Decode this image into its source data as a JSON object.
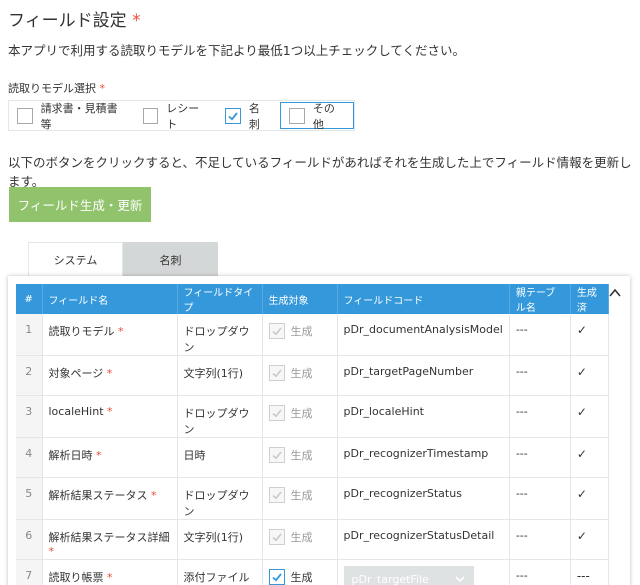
{
  "header": {
    "title": "フィールド設定",
    "required_mark": "*",
    "description": "本アプリで利用する読取りモデルを下記より最低1つ以上チェックしてください。"
  },
  "model_select": {
    "label": "読取りモデル選択",
    "required_mark": "*",
    "options": [
      {
        "label": "請求書・見積書等",
        "checked": false
      },
      {
        "label": "レシート",
        "checked": false
      },
      {
        "label": "名刺",
        "checked": true
      },
      {
        "label": "その他",
        "checked": false
      }
    ]
  },
  "generate": {
    "description": "以下のボタンをクリックすると、不足しているフィールドがあればそれを生成した上でフィールド情報を更新します。",
    "button_label": "フィールド生成・更新"
  },
  "tabs": [
    {
      "label": "システム",
      "active": true
    },
    {
      "label": "名刺",
      "active": false
    }
  ],
  "table": {
    "headers": [
      "#",
      "フィールド名",
      "フィールドタイプ",
      "生成対象",
      "フィールドコード",
      "親テーブル名",
      "生成済"
    ],
    "required_mark": "*",
    "gen_label": "生成",
    "rows": [
      {
        "num": "1",
        "name": "読取りモデル",
        "type": "ドロップダウン",
        "code": "pDr_documentAnalysisModel",
        "parent": "---",
        "done": "✓"
      },
      {
        "num": "2",
        "name": "対象ページ",
        "type": "文字列(1行)",
        "code": "pDr_targetPageNumber",
        "parent": "---",
        "done": "✓"
      },
      {
        "num": "3",
        "name": "localeHint",
        "type": "ドロップダウン",
        "code": "pDr_localeHint",
        "parent": "---",
        "done": "✓"
      },
      {
        "num": "4",
        "name": "解析日時",
        "type": "日時",
        "code": "pDr_recognizerTimestamp",
        "parent": "---",
        "done": "✓"
      },
      {
        "num": "5",
        "name": "解析結果ステータス",
        "type": "ドロップダウン",
        "code": "pDr_recognizerStatus",
        "parent": "---",
        "done": "✓"
      },
      {
        "num": "6",
        "name": "解析結果ステータス詳細",
        "type": "文字列(1行)",
        "code": "pDr_recognizerStatusDetail",
        "parent": "---",
        "done": "✓"
      },
      {
        "num": "7",
        "name": "読取り帳票",
        "type": "添付ファイル",
        "code": "pDr_targetFile",
        "parent": "---",
        "done": "---"
      }
    ]
  },
  "colors": {
    "accent": "#3498db",
    "button": "#91c36c",
    "required": "#e74c3c"
  },
  "icons": {
    "check": "check-icon",
    "collapse": "chevron-up-icon",
    "select": "chevron-down-icon"
  }
}
